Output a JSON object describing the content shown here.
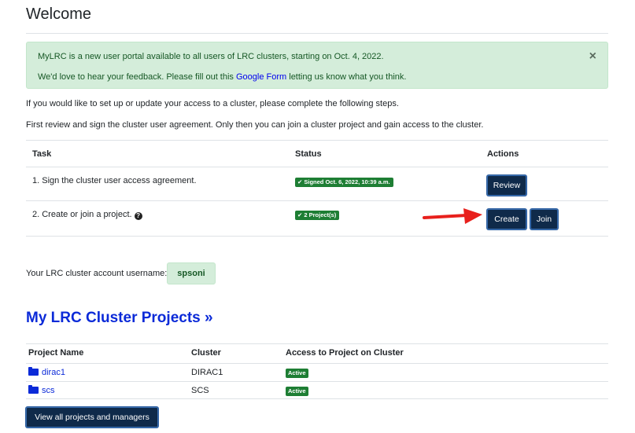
{
  "page": {
    "title": "Welcome"
  },
  "alert": {
    "line1": "MyLRC is a new user portal available to all users of LRC clusters, starting on Oct. 4, 2022.",
    "line2_before": "We'd love to hear your feedback. Please fill out this ",
    "line2_link": "Google Form",
    "line2_after": " letting us know what you think.",
    "close": "×"
  },
  "intro": {
    "line1": "If you would like to set up or update your access to a cluster, please complete the following steps.",
    "line2": "First review and sign the cluster user agreement. Only then you can join a cluster project and gain access to the cluster."
  },
  "tasks": {
    "headers": {
      "task": "Task",
      "status": "Status",
      "actions": "Actions"
    },
    "rows": [
      {
        "task": "1. Sign the cluster user access agreement.",
        "status": "✔ Signed Oct. 6, 2022, 10:39 a.m.",
        "action": "Review"
      },
      {
        "task": "2. Create or join a project.",
        "status": "✔ 2 Project(s)",
        "action_create": "Create",
        "action_join": "Join",
        "help": "?"
      }
    ]
  },
  "account": {
    "label": "Your LRC cluster account username:",
    "username": "spsoni"
  },
  "projects": {
    "heading": "My LRC Cluster Projects »",
    "headers": {
      "name": "Project Name",
      "cluster": "Cluster",
      "access": "Access to Project on Cluster"
    },
    "rows": [
      {
        "name": "dirac1",
        "cluster": "DIRAC1",
        "access": "Active"
      },
      {
        "name": "scs",
        "cluster": "SCS",
        "access": "Active"
      }
    ],
    "view_all": "View all projects and managers"
  },
  "colors": {
    "link": "#0b2ad8",
    "success_bg": "#d4edda",
    "badge": "#1e7e34",
    "button": "#0f2a4a",
    "arrow": "#e8201c"
  }
}
